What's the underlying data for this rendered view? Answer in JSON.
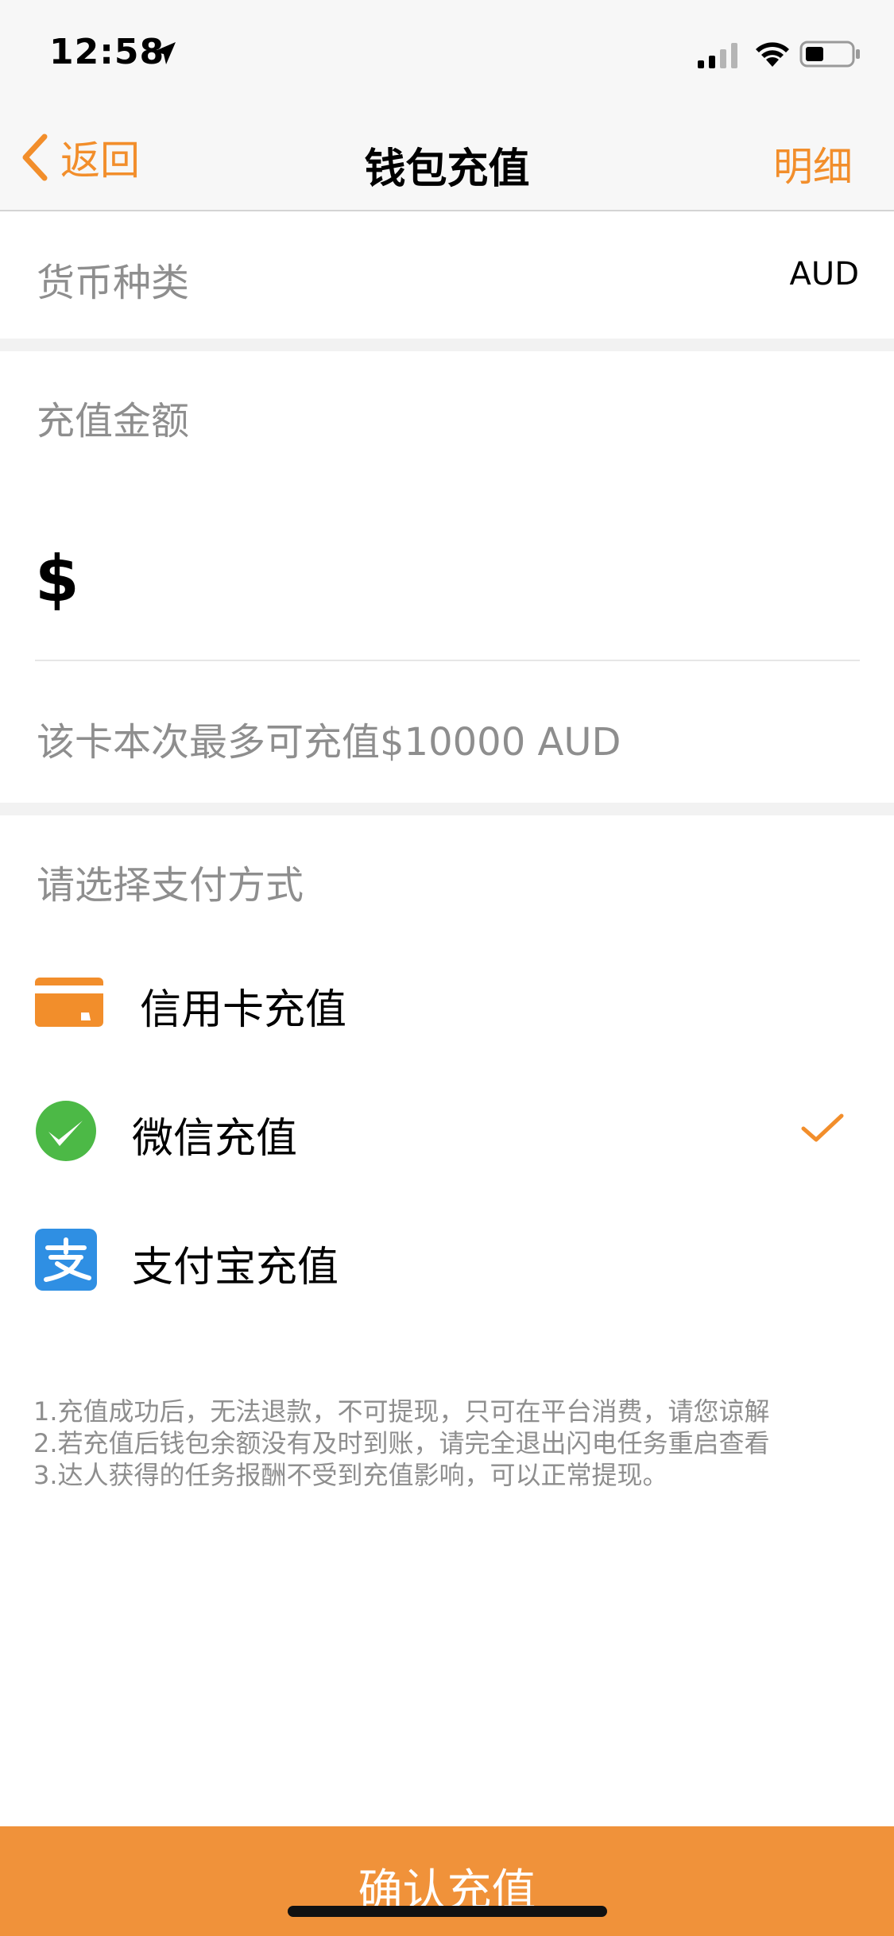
{
  "status_bar": {
    "time": "12:58",
    "icons": [
      "location-arrow-icon",
      "cellular-signal-icon",
      "wifi-icon",
      "battery-icon"
    ]
  },
  "nav": {
    "back_label": "返回",
    "title": "钱包充值",
    "detail_label": "明细"
  },
  "currency": {
    "label": "货币种类",
    "value": "AUD"
  },
  "amount": {
    "label": "充值金额",
    "symbol": "$",
    "value": "",
    "limit_text": "该卡本次最多可充值$10000 AUD"
  },
  "payment": {
    "title": "请选择支付方式",
    "options": [
      {
        "label": "信用卡充值",
        "icon": "credit-card-icon",
        "selected": false
      },
      {
        "label": "微信充值",
        "icon": "wechat-icon",
        "selected": true
      },
      {
        "label": "支付宝充值",
        "icon": "alipay-icon",
        "selected": false
      }
    ]
  },
  "notes": [
    "1.充值成功后，无法退款，不可提现，只可在平台消费，请您谅解",
    "2.若充值后钱包余额没有及时到账，请完全退出闪电任务重启查看",
    "3.达人获得的任务报酬不受到充值影响，可以正常提现。"
  ],
  "confirm_label": "确认充值",
  "colors": {
    "accent": "#f28e2b",
    "confirm_bg": "#f0923a",
    "wechat_green": "#4cb946",
    "alipay_blue": "#2f8fe3",
    "muted_text": "#8e8e8e"
  }
}
